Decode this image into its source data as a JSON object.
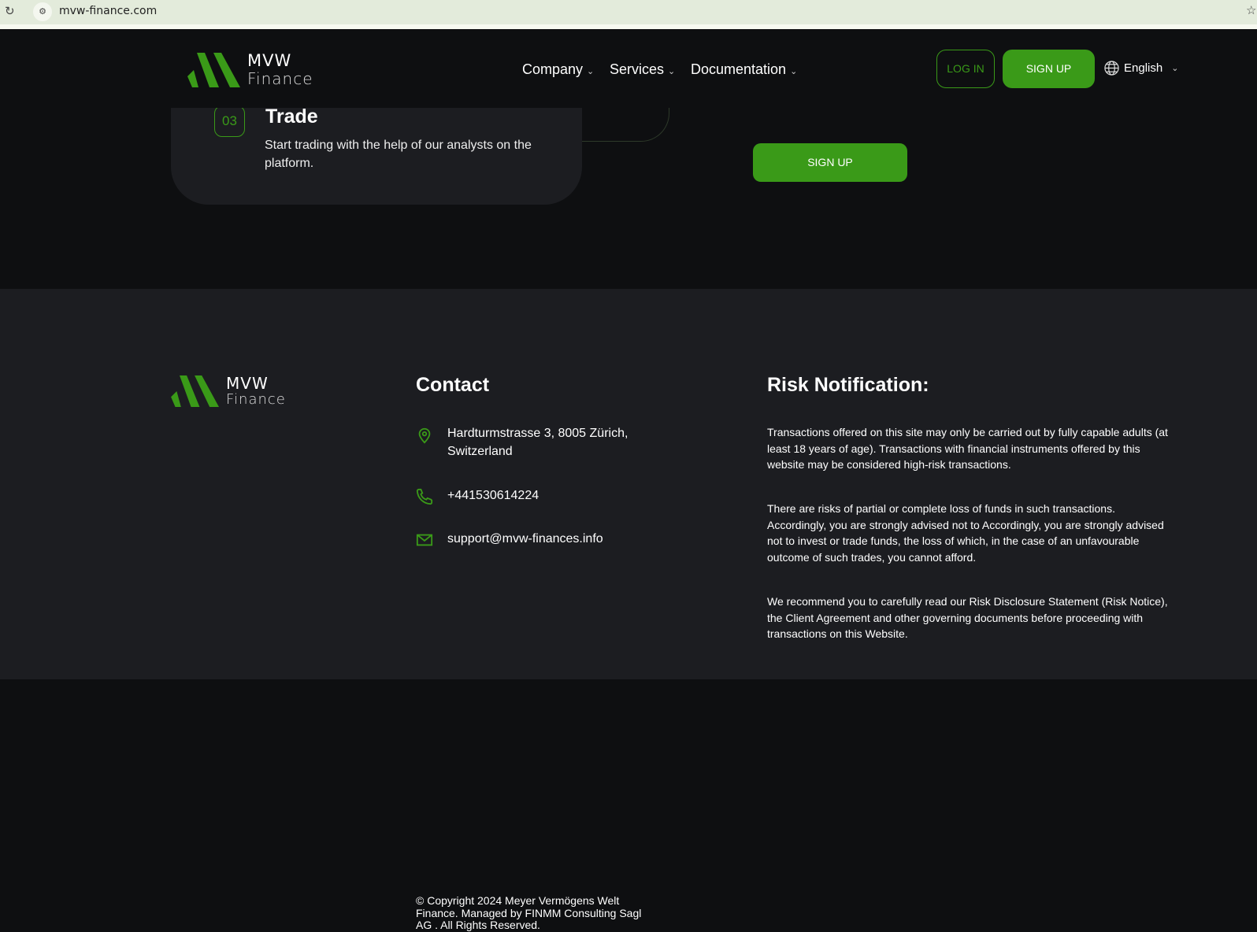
{
  "browser": {
    "url": "mvw-finance.com"
  },
  "brand": {
    "line1": "MVW",
    "line2": "Finance",
    "accent": "#3a9a18"
  },
  "nav": {
    "items": [
      {
        "label": "Company"
      },
      {
        "label": "Services"
      },
      {
        "label": "Documentation"
      }
    ],
    "login": "LOG IN",
    "signup": "SIGN UP",
    "language": "English"
  },
  "step": {
    "number": "03",
    "title": "Trade",
    "description": "Start trading with the help of our analysts on the platform."
  },
  "cta": {
    "signup": "SIGN UP"
  },
  "footer": {
    "contact_title": "Contact",
    "address": "Hardturmstrasse 3, 8005 Zürich, Switzerland",
    "phone": "+441530614224",
    "email": "support@mvw-finances.info",
    "copyright": "© Copyright 2024 Meyer Vermögens Welt Finance. Managed by FINMM Consulting Sagl AG . All Rights Reserved.",
    "risk_title": "Risk Notification:",
    "risk_paragraphs": [
      "Transactions offered on this site may only be carried out by fully capable adults (at least 18 years of age). Transactions with financial instruments offered by this website may be considered high-risk transactions.",
      "There are risks of partial or complete loss of funds in such transactions. Accordingly, you are strongly advised not to Accordingly, you are strongly advised not to invest or trade funds, the loss of which, in the case of an unfavourable outcome of such trades, you cannot afford.",
      "We recommend you to carefully read our Risk Disclosure Statement (Risk Notice), the Client Agreement and other governing documents before proceeding with transactions on this Website."
    ]
  }
}
